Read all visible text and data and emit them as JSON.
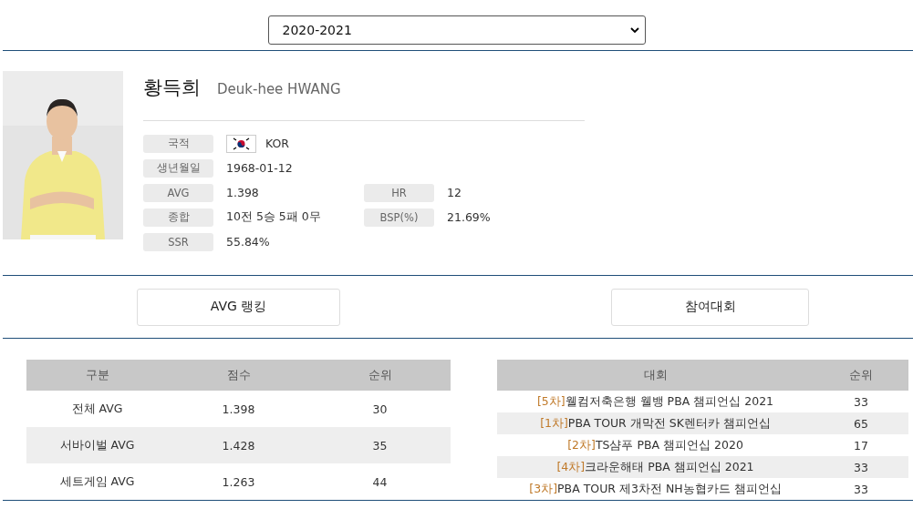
{
  "season_select": {
    "value": "2020-2021"
  },
  "player": {
    "name_ko": "황득희",
    "name_en": "Deuk-hee HWANG",
    "info": [
      {
        "label": "국적",
        "value": "KOR",
        "kind": "flag"
      },
      {
        "label": "생년월일",
        "value": "1968-01-12",
        "kind": "text"
      },
      {
        "label": "AVG",
        "value": "1.398",
        "kind": "text",
        "label2": "HR",
        "value2": "12"
      },
      {
        "label": "종합",
        "value": "10전 5승 5패 0무",
        "kind": "text",
        "label2": "BSP(%)",
        "value2": "21.69%"
      },
      {
        "label": "SSR",
        "value": "55.84%",
        "kind": "text"
      }
    ]
  },
  "tab_buttons": [
    "AVG 랭킹",
    "참여대회"
  ],
  "avg_table": {
    "columns": [
      "구분",
      "점수",
      "순위"
    ],
    "rows": [
      [
        "전체 AVG",
        "1.398",
        "30"
      ],
      [
        "서바이벌 AVG",
        "1.428",
        "35"
      ],
      [
        "세트게임 AVG",
        "1.263",
        "44"
      ]
    ]
  },
  "events_table": {
    "columns": [
      "대회",
      "순위"
    ],
    "rows": [
      {
        "round": "[5차]",
        "name": "웰컴저축은행 웰뱅 PBA 챔피언십 2021",
        "rank": "33"
      },
      {
        "round": "[1차]",
        "name": "PBA TOUR 개막전 SK렌터카 챔피언십",
        "rank": "65"
      },
      {
        "round": "[2차]",
        "name": "TS샴푸 PBA 챔피언십 2020",
        "rank": "17"
      },
      {
        "round": "[4차]",
        "name": "크라운해태 PBA 챔피언십 2021",
        "rank": "33"
      },
      {
        "round": "[3차]",
        "name": "PBA TOUR 제3차전 NH농협카드 챔피언십",
        "rank": "33"
      }
    ]
  }
}
